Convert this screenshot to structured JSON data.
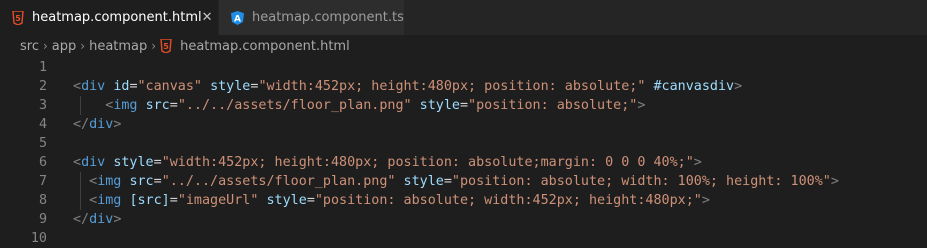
{
  "tabs": [
    {
      "label": "heatmap.component.html",
      "icon": "html-file-icon",
      "active": true,
      "close": "✕"
    },
    {
      "label": "heatmap.component.ts",
      "icon": "angular-file-icon",
      "active": false
    }
  ],
  "breadcrumb": {
    "items": [
      "src",
      "app",
      "heatmap"
    ],
    "file": "heatmap.component.html"
  },
  "colors": {
    "html_icon": "#e44d26",
    "angular_icon": "#1e8ee8",
    "tag_bracket": "#808080",
    "tag_name": "#569cd6",
    "attr": "#9cdcfe",
    "string": "#ce9178"
  },
  "editor": {
    "line_numbers": [
      "1",
      "2",
      "3",
      "4",
      "5",
      "6",
      "7",
      "8",
      "9",
      "10"
    ],
    "lines": [
      [],
      [
        {
          "t": "tag",
          "v": "<"
        },
        {
          "t": "name",
          "v": "div"
        },
        {
          "t": "plain",
          "v": " "
        },
        {
          "t": "attr",
          "v": "id"
        },
        {
          "t": "plain",
          "v": "="
        },
        {
          "t": "str",
          "v": "\"canvas\""
        },
        {
          "t": "plain",
          "v": " "
        },
        {
          "t": "attr",
          "v": "style"
        },
        {
          "t": "plain",
          "v": "="
        },
        {
          "t": "str",
          "v": "\"width:452px; height:480px; position: absolute;\""
        },
        {
          "t": "plain",
          "v": " "
        },
        {
          "t": "attr",
          "v": "#canvasdiv"
        },
        {
          "t": "tag",
          "v": ">"
        }
      ],
      [
        {
          "t": "plain",
          "v": "    "
        },
        {
          "t": "tag",
          "v": "<"
        },
        {
          "t": "name",
          "v": "img"
        },
        {
          "t": "plain",
          "v": " "
        },
        {
          "t": "attr",
          "v": "src"
        },
        {
          "t": "plain",
          "v": "="
        },
        {
          "t": "str",
          "v": "\"../../assets/floor_plan.png\""
        },
        {
          "t": "plain",
          "v": " "
        },
        {
          "t": "attr",
          "v": "style"
        },
        {
          "t": "plain",
          "v": "="
        },
        {
          "t": "str",
          "v": "\"position: absolute;\""
        },
        {
          "t": "tag",
          "v": ">"
        }
      ],
      [
        {
          "t": "tag",
          "v": "</"
        },
        {
          "t": "name",
          "v": "div"
        },
        {
          "t": "tag",
          "v": ">"
        }
      ],
      [],
      [
        {
          "t": "tag",
          "v": "<"
        },
        {
          "t": "name",
          "v": "div"
        },
        {
          "t": "plain",
          "v": " "
        },
        {
          "t": "attr",
          "v": "style"
        },
        {
          "t": "plain",
          "v": "="
        },
        {
          "t": "str",
          "v": "\"width:452px; height:480px; position: absolute;margin: 0 0 0 40%;\""
        },
        {
          "t": "tag",
          "v": ">"
        }
      ],
      [
        {
          "t": "plain",
          "v": "  "
        },
        {
          "t": "tag",
          "v": "<"
        },
        {
          "t": "name",
          "v": "img"
        },
        {
          "t": "plain",
          "v": " "
        },
        {
          "t": "attr",
          "v": "src"
        },
        {
          "t": "plain",
          "v": "="
        },
        {
          "t": "str",
          "v": "\"../../assets/floor_plan.png\""
        },
        {
          "t": "plain",
          "v": " "
        },
        {
          "t": "attr",
          "v": "style"
        },
        {
          "t": "plain",
          "v": "="
        },
        {
          "t": "str",
          "v": "\"position: absolute; width: 100%; height: 100%\""
        },
        {
          "t": "tag",
          "v": ">"
        }
      ],
      [
        {
          "t": "plain",
          "v": "  "
        },
        {
          "t": "tag",
          "v": "<"
        },
        {
          "t": "name",
          "v": "img"
        },
        {
          "t": "plain",
          "v": " "
        },
        {
          "t": "attr",
          "v": "[src]"
        },
        {
          "t": "plain",
          "v": "="
        },
        {
          "t": "str",
          "v": "\"imageUrl\""
        },
        {
          "t": "plain",
          "v": " "
        },
        {
          "t": "attr",
          "v": "style"
        },
        {
          "t": "plain",
          "v": "="
        },
        {
          "t": "str",
          "v": "\"position: absolute; width:452px; height:480px;\""
        },
        {
          "t": "tag",
          "v": ">"
        }
      ],
      [
        {
          "t": "tag",
          "v": "</"
        },
        {
          "t": "name",
          "v": "div"
        },
        {
          "t": "tag",
          "v": ">"
        }
      ],
      []
    ]
  }
}
